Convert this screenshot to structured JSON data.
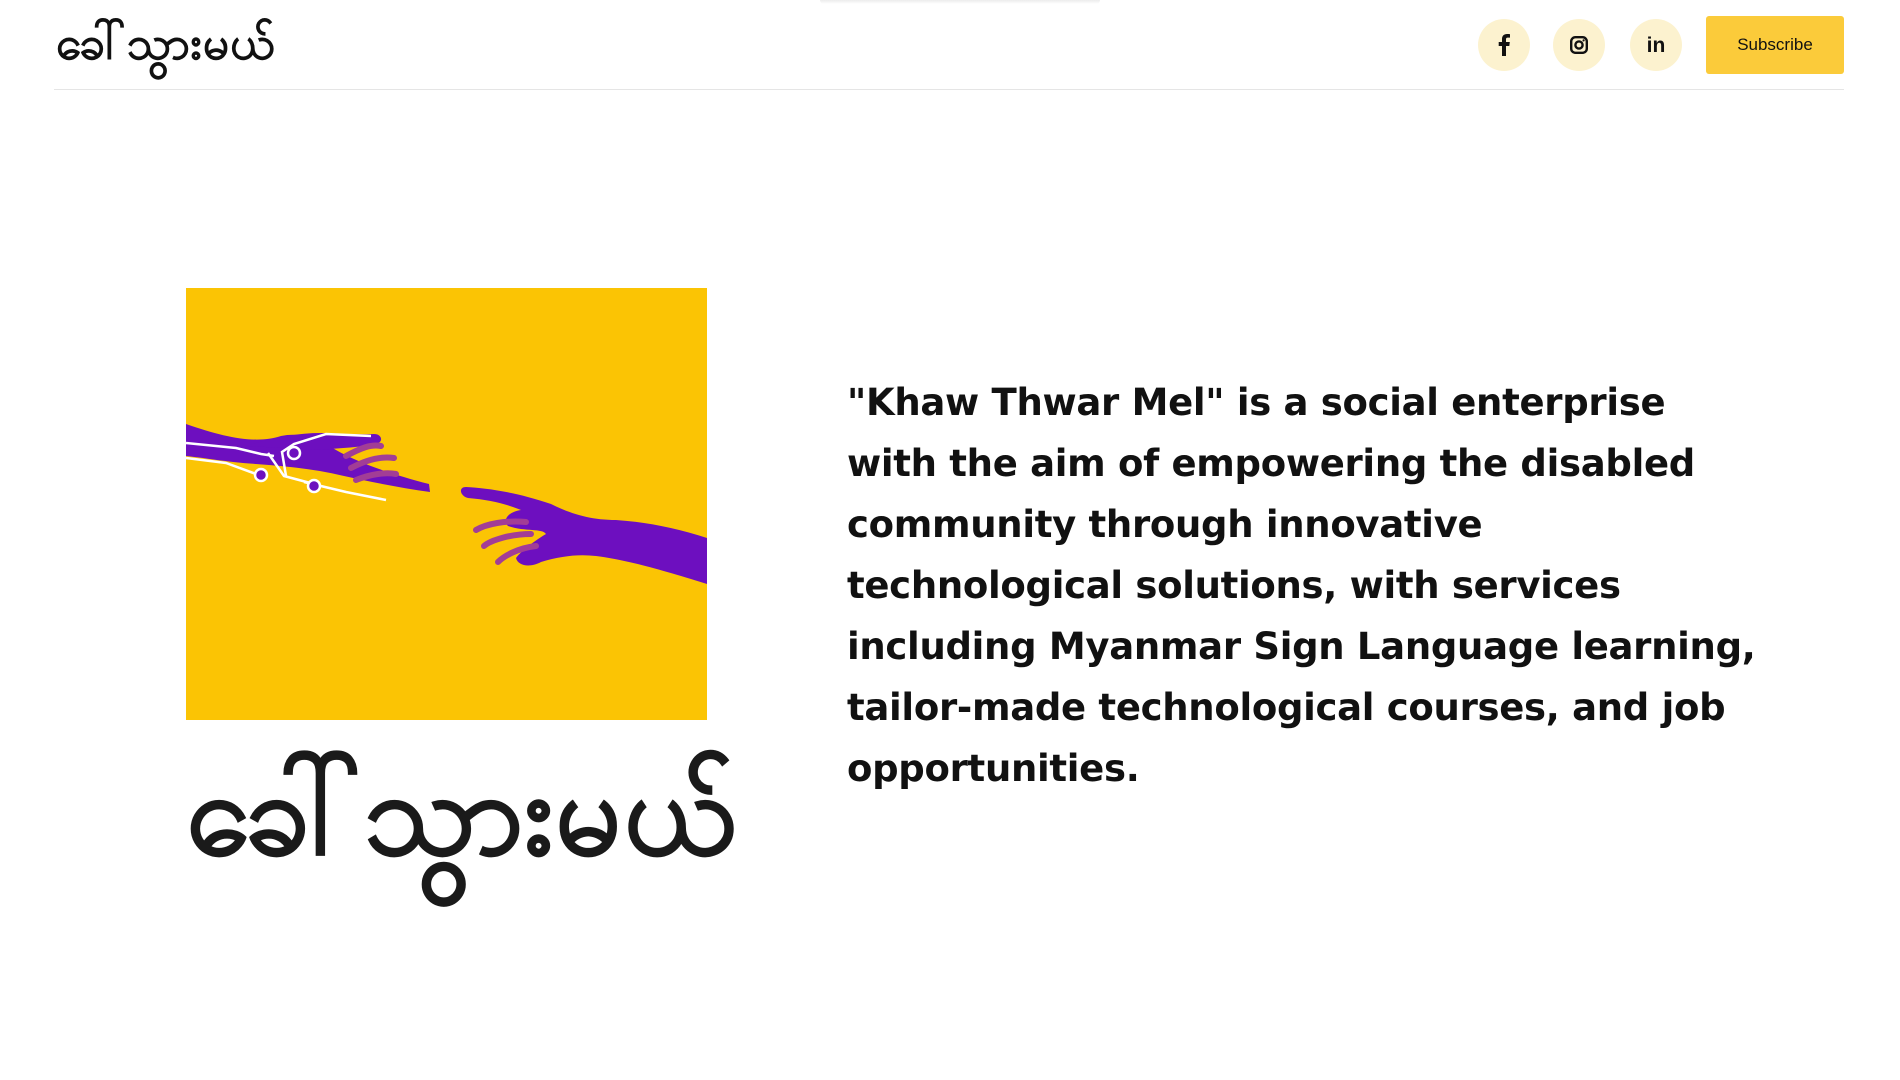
{
  "header": {
    "brand": "ခေါ်သွားမယ်",
    "social": [
      {
        "icon": "facebook-icon",
        "label": "f"
      },
      {
        "icon": "instagram-icon",
        "label": ""
      },
      {
        "icon": "linkedin-icon",
        "label": "in"
      }
    ],
    "subscribe_label": "Subscribe"
  },
  "hero": {
    "logo_text": "ခေါ်သွားမယ်",
    "description": "\"Khaw Thwar Mel\" is a social enterprise with the aim of empowering the disabled community through innovative technological solutions, with services including Myanmar Sign Language learning, tailor-made technological courses, and job opportunities."
  },
  "colors": {
    "accent": "#fbcb3a",
    "image_background": "#fbc404",
    "hand_purple": "#6d0fbf",
    "social_button_bg": "#fcf2cf"
  }
}
